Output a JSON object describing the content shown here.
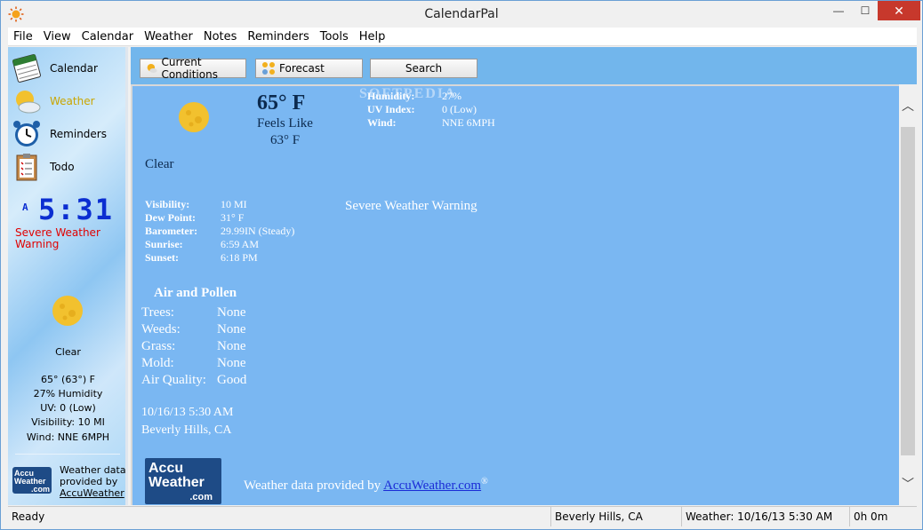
{
  "window": {
    "title": "CalendarPal",
    "close_glyph": "✕",
    "min_glyph": "—",
    "max_glyph": "☐"
  },
  "menu": [
    "File",
    "View",
    "Calendar",
    "Weather",
    "Notes",
    "Reminders",
    "Tools",
    "Help"
  ],
  "sidebar": {
    "items": [
      {
        "label": "Calendar",
        "icon": "calendar-icon"
      },
      {
        "label": "Weather",
        "icon": "weather-sun-cloud-icon",
        "active": true
      },
      {
        "label": "Reminders",
        "icon": "alarm-clock-icon"
      },
      {
        "label": "Todo",
        "icon": "clipboard-checklist-icon"
      }
    ],
    "clock_ampm": "A",
    "clock_time": "5:31",
    "warning": "Severe Weather Warning",
    "condition": "Clear",
    "temp": "65° (63°) F",
    "humidity": "27% Humidity",
    "uv": "UV: 0 (Low)",
    "visibility": "Visibility: 10 MI",
    "wind": "Wind: NNE 6MPH",
    "logo_lines": [
      "Accu",
      "Weather",
      ".com"
    ],
    "credit_line1": "Weather data",
    "credit_line2": "provided by",
    "credit_link": "AccuWeather"
  },
  "toolbar": {
    "current_label": "Current Conditions",
    "forecast_label": "Forecast",
    "search_label": "Search"
  },
  "main": {
    "temp": "65° F",
    "feels_like_label": "Feels Like",
    "feels_like_value": "63° F",
    "watermark": "SOFTPEDIA",
    "stats": [
      {
        "k": "Humidity:",
        "v": "27%"
      },
      {
        "k": "UV Index:",
        "v": "0 (Low)"
      },
      {
        "k": "Wind:",
        "v": "NNE 6MPH"
      }
    ],
    "condition": "Clear",
    "details": [
      {
        "k": "Visibility:",
        "v": "10 MI"
      },
      {
        "k": "Dew Point:",
        "v": "31° F"
      },
      {
        "k": "Barometer:",
        "v": "29.99IN (Steady)"
      },
      {
        "k": "Sunrise:",
        "v": "6:59 AM"
      },
      {
        "k": "Sunset:",
        "v": "6:18 PM"
      }
    ],
    "severe": "Severe Weather Warning",
    "air_title": "Air and Pollen",
    "air": [
      {
        "k": "Trees:",
        "v": "None"
      },
      {
        "k": "Weeds:",
        "v": "None"
      },
      {
        "k": "Grass:",
        "v": "None"
      },
      {
        "k": "Mold:",
        "v": "None"
      },
      {
        "k": "Air Quality:",
        "v": "Good"
      }
    ],
    "date": "10/16/13 5:30 AM",
    "location": "Beverly Hills, CA",
    "logo_line1": "Accu",
    "logo_line2": "Weather",
    "logo_line3": ".com",
    "credit_prefix": "Weather data provided by ",
    "credit_link": "AccuWeather.com",
    "credit_reg": "®"
  },
  "status": {
    "ready": "Ready",
    "location": "Beverly Hills, CA",
    "weather": "Weather: 10/16/13 5:30 AM",
    "elapsed": "0h 0m"
  },
  "colors": {
    "accent": "#72b6ec",
    "close": "#c7382c",
    "warning": "#e00000",
    "clock": "#0b2ed1"
  }
}
